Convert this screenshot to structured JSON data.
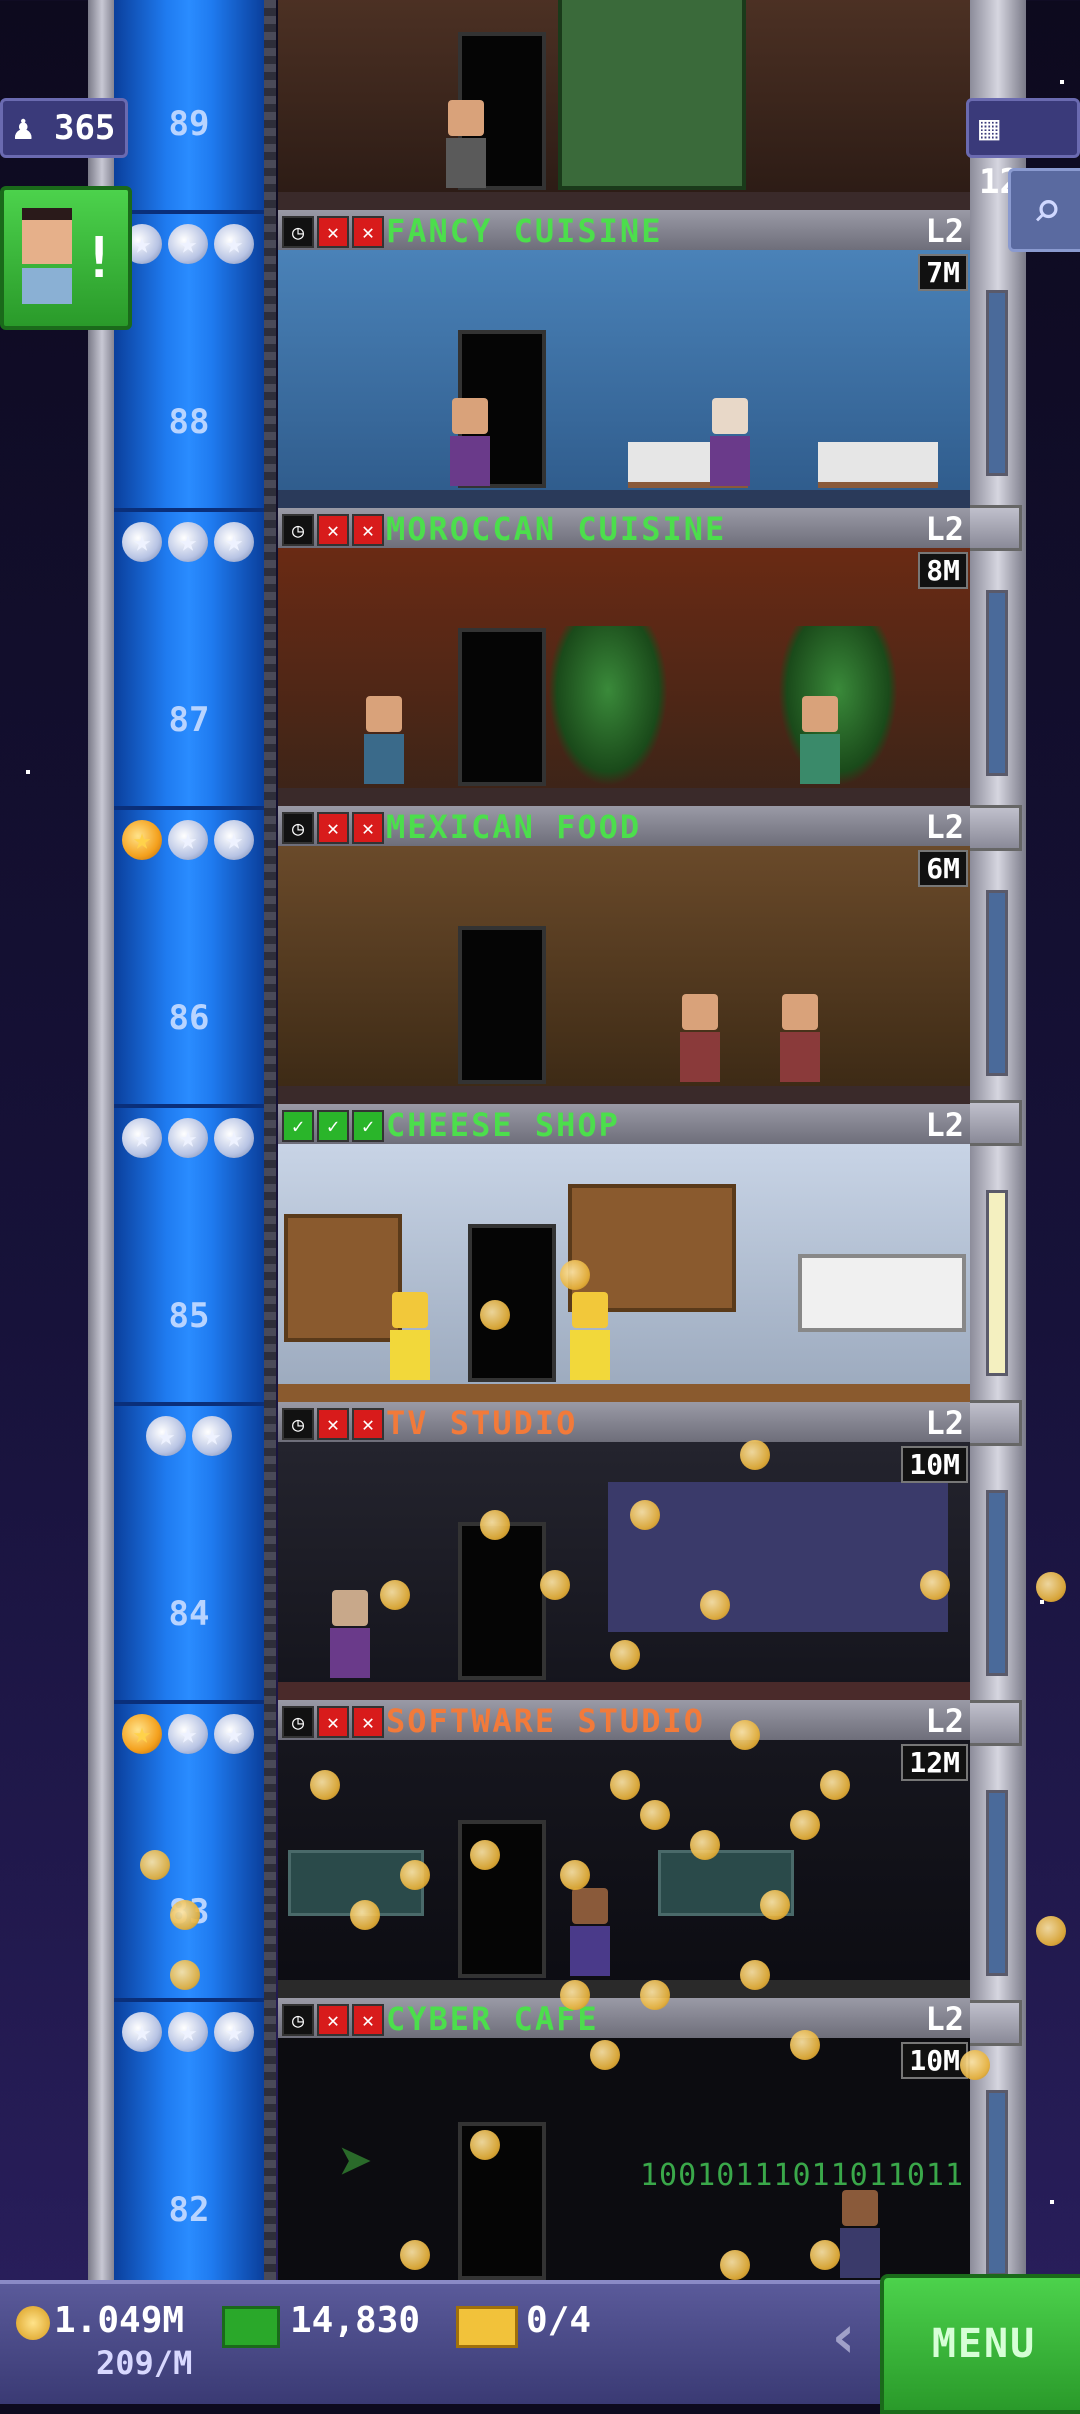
{
  "hud": {
    "population": "365",
    "floors_count": "127",
    "population_icon": "person-icon",
    "floors_icon": "building-icon"
  },
  "floors": [
    {
      "number": "89",
      "stars": [],
      "name": "",
      "level": "",
      "timer": ""
    },
    {
      "number": "88",
      "stars": [
        "silver",
        "silver",
        "silver"
      ],
      "slots": [
        "clock",
        "x",
        "x"
      ],
      "name": "FANCY CUISINE",
      "name_color": "green",
      "level": "L2",
      "timer": "7M"
    },
    {
      "number": "87",
      "stars": [
        "silver",
        "silver",
        "silver"
      ],
      "slots": [
        "clock",
        "x",
        "x"
      ],
      "name": "MOROCCAN CUISINE",
      "name_color": "green",
      "level": "L2",
      "timer": "8M"
    },
    {
      "number": "86",
      "stars": [
        "gold",
        "silver",
        "silver"
      ],
      "slots": [
        "clock",
        "x",
        "x"
      ],
      "name": "MEXICAN FOOD",
      "name_color": "green",
      "level": "L2",
      "timer": "6M"
    },
    {
      "number": "85",
      "stars": [
        "silver",
        "silver",
        "silver"
      ],
      "slots": [
        "check",
        "check",
        "check"
      ],
      "name": "CHEESE SHOP",
      "name_color": "green",
      "level": "L2",
      "timer": ""
    },
    {
      "number": "84",
      "stars": [
        "silver",
        "silver"
      ],
      "slots": [
        "clock",
        "x",
        "x"
      ],
      "name": "TV STUDIO",
      "name_color": "orange",
      "level": "L2",
      "timer": "10M"
    },
    {
      "number": "83",
      "stars": [
        "gold",
        "silver",
        "silver"
      ],
      "slots": [
        "clock",
        "x",
        "x"
      ],
      "name": "SOFTWARE STUDIO",
      "name_color": "orange",
      "level": "L2",
      "timer": "12M"
    },
    {
      "number": "82",
      "stars": [
        "silver",
        "silver",
        "silver"
      ],
      "slots": [
        "clock",
        "x",
        "x"
      ],
      "name": "CYBER CAFE",
      "name_color": "green",
      "level": "L2",
      "timer": "10M"
    }
  ],
  "cyber_cafe_binary": "10010111011011011",
  "bottom_bar": {
    "coins": "1.049M",
    "coin_rate": "209/M",
    "bux": "14,830",
    "tickets": "0/4",
    "menu_label": "MENU",
    "back_icon": "chevron-left-icon"
  },
  "icons": {
    "notification": "citizen-alert-icon",
    "search": "magnifier-icon"
  }
}
